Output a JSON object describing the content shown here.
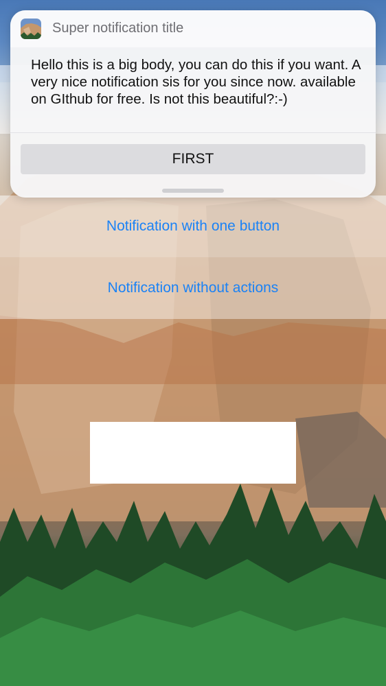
{
  "notification": {
    "app_icon": "mountain-photo-icon",
    "title": "Super notification title",
    "body": "Hello this is a big body, you can do this if you want. A very nice notification sis for you since now. available on GIthub for free. Is not this beautiful?:-)",
    "action_label": "FIRST"
  },
  "list": {
    "items": [
      {
        "label": "Notification with one button"
      },
      {
        "label": "Notification without actions"
      }
    ]
  },
  "colors": {
    "link": "#1b82f5",
    "card": "#f6f6f7",
    "action_button": "#dcdcdf"
  }
}
